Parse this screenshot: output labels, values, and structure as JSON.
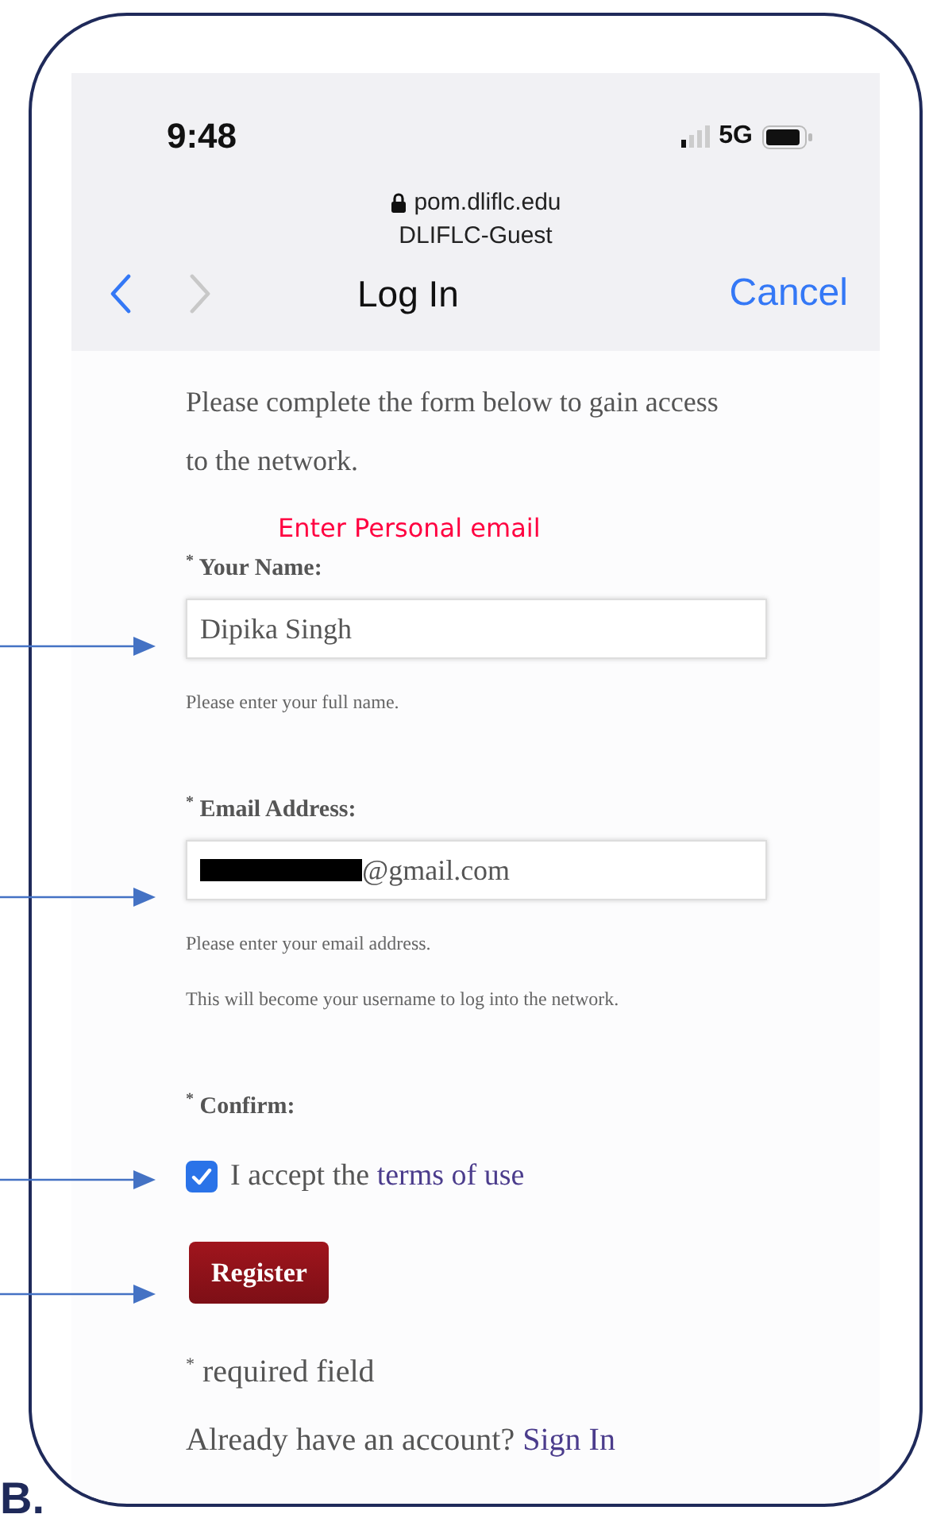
{
  "status_bar": {
    "time": "9:48",
    "network": "5G"
  },
  "address": {
    "domain": "pom.dliflc.edu",
    "network_name": "DLIFLC-Guest"
  },
  "nav": {
    "back_enabled": true,
    "forward_enabled": false,
    "title": "Log In",
    "cancel": "Cancel"
  },
  "intro": "Please complete the form below to gain access to the network.",
  "annotation": "Enter Personal email",
  "fields": [
    {
      "label": "$^{*}$ Your Name:",
      "value": "Dipika Singh",
      "redacted": false,
      "hints": [
        "Please enter your full name."
      ]
    },
    {
      "label": "$^{*}$ Email Address:",
      "value": "@gmail.com",
      "redacted": true,
      "hints": [
        "Please enter your email address.",
        "This will become your username to log into the network."
      ]
    }
  ],
  "confirm": {
    "label": "$^{*}$ Confirm:",
    "checked": true,
    "text": "I accept the",
    "link": "terms of use"
  },
  "button": "Register",
  "required_note": "$^{*}$ required field",
  "signin": {
    "text": "Already have an account?",
    "link": "Sign In"
  },
  "figure_label": "B."
}
